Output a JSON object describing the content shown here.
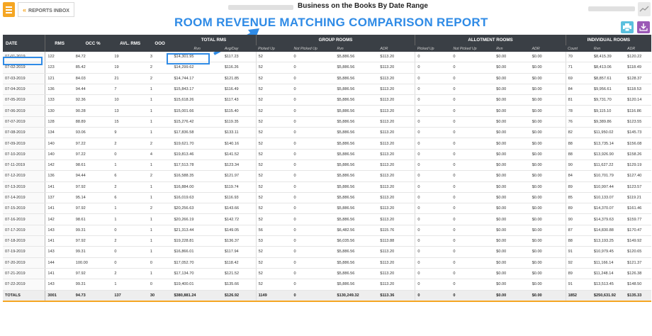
{
  "header": {
    "inbox_label": "REPORTS INBOX",
    "page_title": "Business on the Books By Date Range",
    "overlay_title": "ROOM REVENUE MATCHING COMPARISON REPORT"
  },
  "columns": {
    "date": "DATE",
    "rms": "RMS",
    "occ": "OCC %",
    "avl": "AVL. RMS",
    "ooo": "OOO",
    "total_rms": "TOTAL RMS",
    "group_rooms": "GROUP ROOMS",
    "allotment_rooms": "ALLOTMENT ROOMS",
    "individual_rooms": "INDIVIDUAL ROOMS",
    "sub": {
      "total_rvn": "Rvn",
      "total_adr": "Avg/Day",
      "group_picked": "Picked Up",
      "group_not_picked": "Not Picked Up",
      "group_rvn": "Rvn",
      "group_adr": "ADR",
      "allot_picked": "Picked Up",
      "allot_not_picked": "Not Picked Up",
      "allot_rvn": "Rvn",
      "allot_adr": "ADR",
      "ind_count": "Count",
      "ind_rvn": "Rvn",
      "ind_adr": "ADR"
    }
  },
  "rows": [
    [
      "07-01-2019",
      "122",
      "84.72",
      "19",
      "3",
      "$14,301.95",
      "$117.23",
      "52",
      "0",
      "$5,886.56",
      "$113.20",
      "0",
      "0",
      "$0.00",
      "$0.00",
      "70",
      "$8,415.39",
      "$120.22"
    ],
    [
      "07-02-2019",
      "123",
      "85.42",
      "19",
      "2",
      "$14,299.62",
      "$116.26",
      "52",
      "0",
      "$5,886.56",
      "$113.20",
      "0",
      "0",
      "$0.00",
      "$0.00",
      "71",
      "$8,413.06",
      "$118.49"
    ],
    [
      "07-03-2019",
      "121",
      "84.03",
      "21",
      "2",
      "$14,744.17",
      "$121.85",
      "52",
      "0",
      "$5,886.56",
      "$113.20",
      "0",
      "0",
      "$0.00",
      "$0.00",
      "69",
      "$8,857.61",
      "$128.37"
    ],
    [
      "07-04-2019",
      "136",
      "94.44",
      "7",
      "1",
      "$15,843.17",
      "$116.49",
      "52",
      "0",
      "$5,886.56",
      "$113.20",
      "0",
      "0",
      "$0.00",
      "$0.00",
      "84",
      "$9,956.61",
      "$118.53"
    ],
    [
      "07-05-2019",
      "133",
      "92.36",
      "10",
      "1",
      "$15,618.26",
      "$117.43",
      "52",
      "0",
      "$5,886.56",
      "$113.20",
      "0",
      "0",
      "$0.00",
      "$0.00",
      "81",
      "$9,731.70",
      "$120.14"
    ],
    [
      "07-06-2019",
      "130",
      "90.28",
      "13",
      "1",
      "$15,001.66",
      "$115.40",
      "52",
      "0",
      "$5,886.56",
      "$113.20",
      "0",
      "0",
      "$0.00",
      "$0.00",
      "78",
      "$9,115.10",
      "$116.86"
    ],
    [
      "07-07-2019",
      "128",
      "88.89",
      "15",
      "1",
      "$15,276.42",
      "$119.35",
      "52",
      "0",
      "$5,886.56",
      "$113.20",
      "0",
      "0",
      "$0.00",
      "$0.00",
      "76",
      "$9,389.86",
      "$123.55"
    ],
    [
      "07-08-2019",
      "134",
      "93.06",
      "9",
      "1",
      "$17,836.58",
      "$133.11",
      "52",
      "0",
      "$5,886.56",
      "$113.20",
      "0",
      "0",
      "$0.00",
      "$0.00",
      "82",
      "$11,950.02",
      "$145.73"
    ],
    [
      "07-09-2019",
      "140",
      "97.22",
      "2",
      "2",
      "$19,621.70",
      "$140.16",
      "52",
      "0",
      "$5,886.56",
      "$113.20",
      "0",
      "0",
      "$0.00",
      "$0.00",
      "88",
      "$13,735.14",
      "$156.08"
    ],
    [
      "07-10-2019",
      "140",
      "97.22",
      "0",
      "4",
      "$19,813.46",
      "$141.52",
      "52",
      "0",
      "$5,886.56",
      "$113.20",
      "0",
      "0",
      "$0.00",
      "$0.00",
      "88",
      "$13,926.90",
      "$158.26"
    ],
    [
      "07-11-2019",
      "142",
      "98.61",
      "1",
      "1",
      "$17,513.78",
      "$123.34",
      "52",
      "0",
      "$5,886.56",
      "$113.20",
      "0",
      "0",
      "$0.00",
      "$0.00",
      "90",
      "$11,627.22",
      "$129.19"
    ],
    [
      "07-12-2019",
      "136",
      "94.44",
      "6",
      "2",
      "$16,588.35",
      "$121.97",
      "52",
      "0",
      "$5,886.56",
      "$113.20",
      "0",
      "0",
      "$0.00",
      "$0.00",
      "84",
      "$10,701.79",
      "$127.40"
    ],
    [
      "07-13-2019",
      "141",
      "97.92",
      "2",
      "1",
      "$16,884.00",
      "$119.74",
      "52",
      "0",
      "$5,886.56",
      "$113.20",
      "0",
      "0",
      "$0.00",
      "$0.00",
      "89",
      "$10,997.44",
      "$123.57"
    ],
    [
      "07-14-2019",
      "137",
      "95.14",
      "6",
      "1",
      "$16,019.63",
      "$116.93",
      "52",
      "0",
      "$5,886.56",
      "$113.20",
      "0",
      "0",
      "$0.00",
      "$0.00",
      "85",
      "$10,133.07",
      "$119.21"
    ],
    [
      "07-15-2019",
      "141",
      "97.92",
      "1",
      "2",
      "$20,256.63",
      "$143.66",
      "52",
      "0",
      "$5,886.56",
      "$113.20",
      "0",
      "0",
      "$0.00",
      "$0.00",
      "89",
      "$14,370.07",
      "$161.46"
    ],
    [
      "07-16-2019",
      "142",
      "98.61",
      "1",
      "1",
      "$20,266.19",
      "$142.72",
      "52",
      "0",
      "$5,886.56",
      "$113.20",
      "0",
      "0",
      "$0.00",
      "$0.00",
      "90",
      "$14,379.63",
      "$159.77"
    ],
    [
      "07-17-2019",
      "143",
      "99.31",
      "0",
      "1",
      "$21,313.44",
      "$149.05",
      "56",
      "0",
      "$6,482.56",
      "$115.76",
      "0",
      "0",
      "$0.00",
      "$0.00",
      "87",
      "$14,830.88",
      "$170.47"
    ],
    [
      "07-18-2019",
      "141",
      "97.92",
      "2",
      "1",
      "$19,228.81",
      "$136.37",
      "53",
      "0",
      "$6,035.56",
      "$113.88",
      "0",
      "0",
      "$0.00",
      "$0.00",
      "88",
      "$13,193.25",
      "$149.92"
    ],
    [
      "07-19-2019",
      "143",
      "99.31",
      "0",
      "1",
      "$16,866.01",
      "$117.94",
      "52",
      "0",
      "$5,886.56",
      "$113.20",
      "0",
      "0",
      "$0.00",
      "$0.00",
      "91",
      "$10,979.45",
      "$120.65"
    ],
    [
      "07-20-2019",
      "144",
      "100.00",
      "0",
      "0",
      "$17,052.70",
      "$118.42",
      "52",
      "0",
      "$5,886.56",
      "$113.20",
      "0",
      "0",
      "$0.00",
      "$0.00",
      "92",
      "$11,166.14",
      "$121.37"
    ],
    [
      "07-21-2019",
      "141",
      "97.92",
      "2",
      "1",
      "$17,134.70",
      "$121.52",
      "52",
      "0",
      "$5,886.56",
      "$113.20",
      "0",
      "0",
      "$0.00",
      "$0.00",
      "89",
      "$11,248.14",
      "$126.38"
    ],
    [
      "07-22-2019",
      "143",
      "99.31",
      "1",
      "0",
      "$19,400.01",
      "$135.66",
      "52",
      "0",
      "$5,886.56",
      "$113.20",
      "0",
      "0",
      "$0.00",
      "$0.00",
      "91",
      "$13,513.45",
      "$148.50"
    ]
  ],
  "totals": [
    "TOTALS",
    "3001",
    "94.73",
    "137",
    "30",
    "$380,881.24",
    "$126.92",
    "1149",
    "0",
    "$130,249.32",
    "$113.36",
    "0",
    "0",
    "$0.00",
    "$0.00",
    "1852",
    "$250,631.92",
    "$135.33"
  ],
  "colors": {
    "accent": "#f5a623",
    "highlight": "#2f8be6",
    "header_bg": "#3a3f45",
    "print_btn": "#5bc0de",
    "download_btn": "#9b59b6"
  },
  "icons": {
    "menu": "hamburger-icon",
    "back": "chevrons-left-icon",
    "trend": "trend-chart-icon",
    "print": "print-icon",
    "download": "download-icon"
  }
}
